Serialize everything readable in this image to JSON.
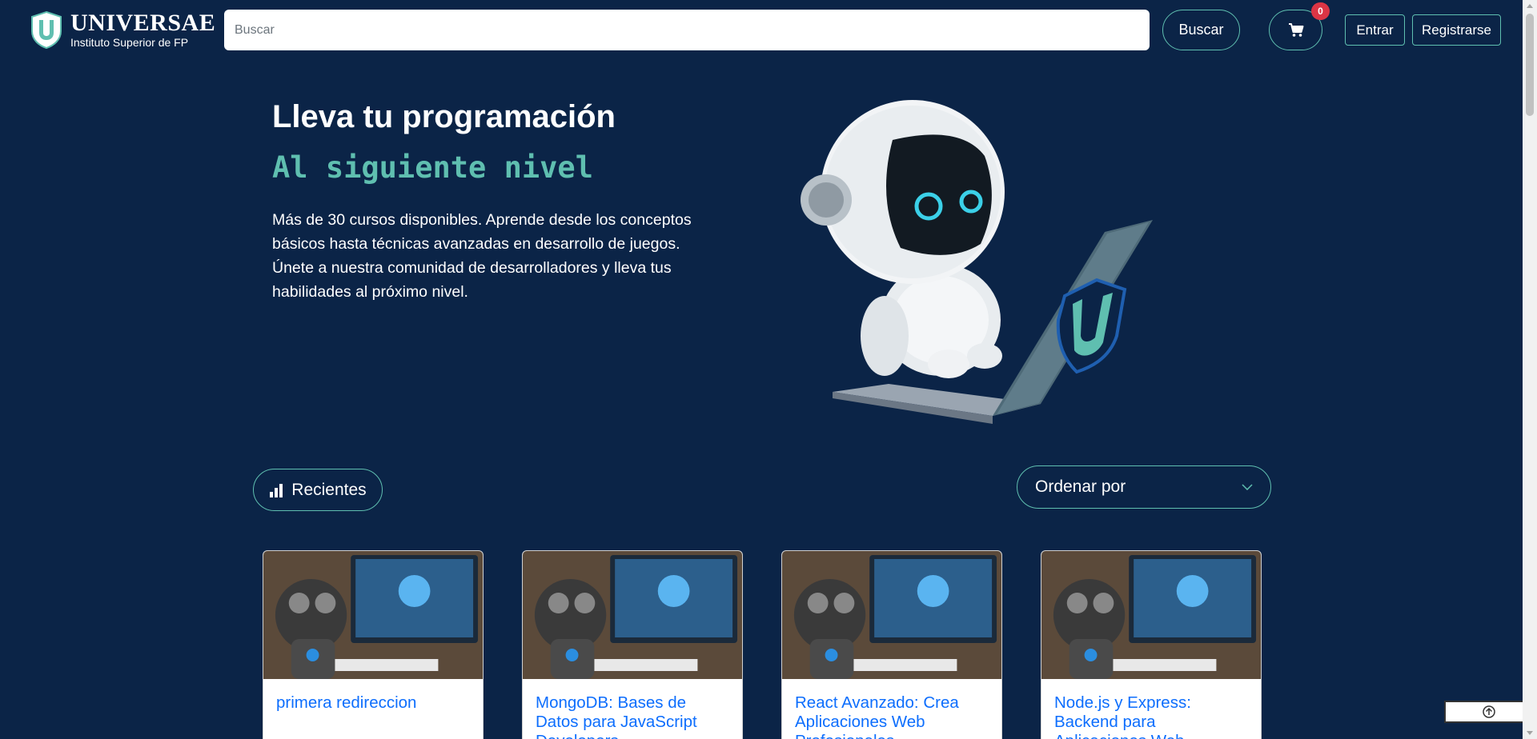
{
  "brand": {
    "title": "UNIVERSAE",
    "subtitle": "Instituto Superior de FP"
  },
  "search": {
    "placeholder": "Buscar",
    "button_label": "Buscar"
  },
  "cart": {
    "count": "0"
  },
  "auth": {
    "login_label": "Entrar",
    "register_label": "Registrarse"
  },
  "hero": {
    "title": "Lleva tu programación",
    "subtitle": "Al siguiente nivel",
    "description": "Más de 30 cursos disponibles. Aprende desde los conceptos básicos hasta técnicas avanzadas en desarrollo de juegos. Únete a nuestra comunidad de desarrolladores y lleva tus habilidades al próximo nivel."
  },
  "filters": {
    "recent_label": "Recientes",
    "sort_label": "Ordenar por"
  },
  "courses": [
    {
      "title": "primera redireccion"
    },
    {
      "title": "MongoDB: Bases de Datos para JavaScript Developers"
    },
    {
      "title": "React Avanzado: Crea Aplicaciones Web Profesionales"
    },
    {
      "title": "Node.js y Express: Backend para Aplicaciones Web"
    }
  ],
  "colors": {
    "background": "#0b2447",
    "accent": "#5fbfb0",
    "link": "#0d6efd",
    "badge": "#dc3545"
  },
  "icons": {
    "cart": "cart-icon",
    "recent": "bar-chart-icon",
    "sort": "chevron-down-icon",
    "back_to_top": "arrow-up-circle-icon"
  }
}
